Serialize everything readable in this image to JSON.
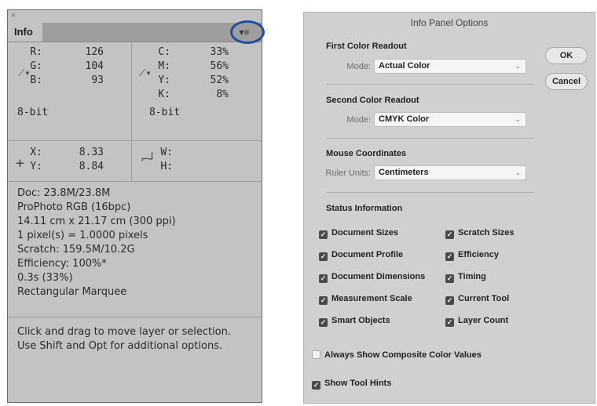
{
  "info_panel": {
    "close_glyph": "×",
    "tab_label": "Info",
    "menu_glyph": "▾≡",
    "color1": {
      "labels": [
        "R:",
        "G:",
        "B:"
      ],
      "values": [
        "126",
        "104",
        "93"
      ],
      "bit": "8-bit"
    },
    "color2": {
      "labels": [
        "C:",
        "M:",
        "Y:",
        "K:"
      ],
      "values": [
        "33%",
        "56%",
        "52%",
        "8%"
      ],
      "bit": "8-bit"
    },
    "coords": {
      "x_label": "X:",
      "x_value": "8.33",
      "y_label": "Y:",
      "y_value": "8.84"
    },
    "size": {
      "w_label": "W:",
      "w_value": "",
      "h_label": "H:",
      "h_value": ""
    },
    "doc_lines": [
      "Doc: 23.8M/23.8M",
      "ProPhoto RGB (16bpc)",
      "14.11 cm x 21.17 cm (300 ppi)",
      "1 pixel(s) = 1.0000 pixels",
      "Scratch: 159.5M/10.2G",
      "Efficiency: 100%*",
      "0.3s (33%)",
      "Rectangular Marquee"
    ],
    "hint_lines": [
      "Click and drag to move layer or selection.",
      "Use Shift and Opt for additional options."
    ]
  },
  "dialog": {
    "title": "Info Panel Options",
    "ok_label": "OK",
    "cancel_label": "Cancel",
    "first_color": {
      "heading": "First Color Readout",
      "mode_label": "Mode:",
      "mode_value": "Actual Color"
    },
    "second_color": {
      "heading": "Second Color Readout",
      "mode_label": "Mode:",
      "mode_value": "CMYK Color"
    },
    "mouse": {
      "heading": "Mouse Coordinates",
      "units_label": "Ruler Units:",
      "units_value": "Centimeters"
    },
    "status": {
      "heading": "Status Information",
      "left": [
        {
          "label": "Document Sizes",
          "checked": true
        },
        {
          "label": "Document Profile",
          "checked": true
        },
        {
          "label": "Document Dimensions",
          "checked": true
        },
        {
          "label": "Measurement Scale",
          "checked": true
        },
        {
          "label": "Smart Objects",
          "checked": true
        }
      ],
      "right": [
        {
          "label": "Scratch Sizes",
          "checked": true
        },
        {
          "label": "Efficiency",
          "checked": true
        },
        {
          "label": "Timing",
          "checked": true
        },
        {
          "label": "Current Tool",
          "checked": true
        },
        {
          "label": "Layer Count",
          "checked": true
        }
      ]
    },
    "composite": {
      "label": "Always Show Composite Color Values",
      "checked": false
    },
    "tool_hints": {
      "label": "Show Tool Hints",
      "checked": true
    }
  }
}
